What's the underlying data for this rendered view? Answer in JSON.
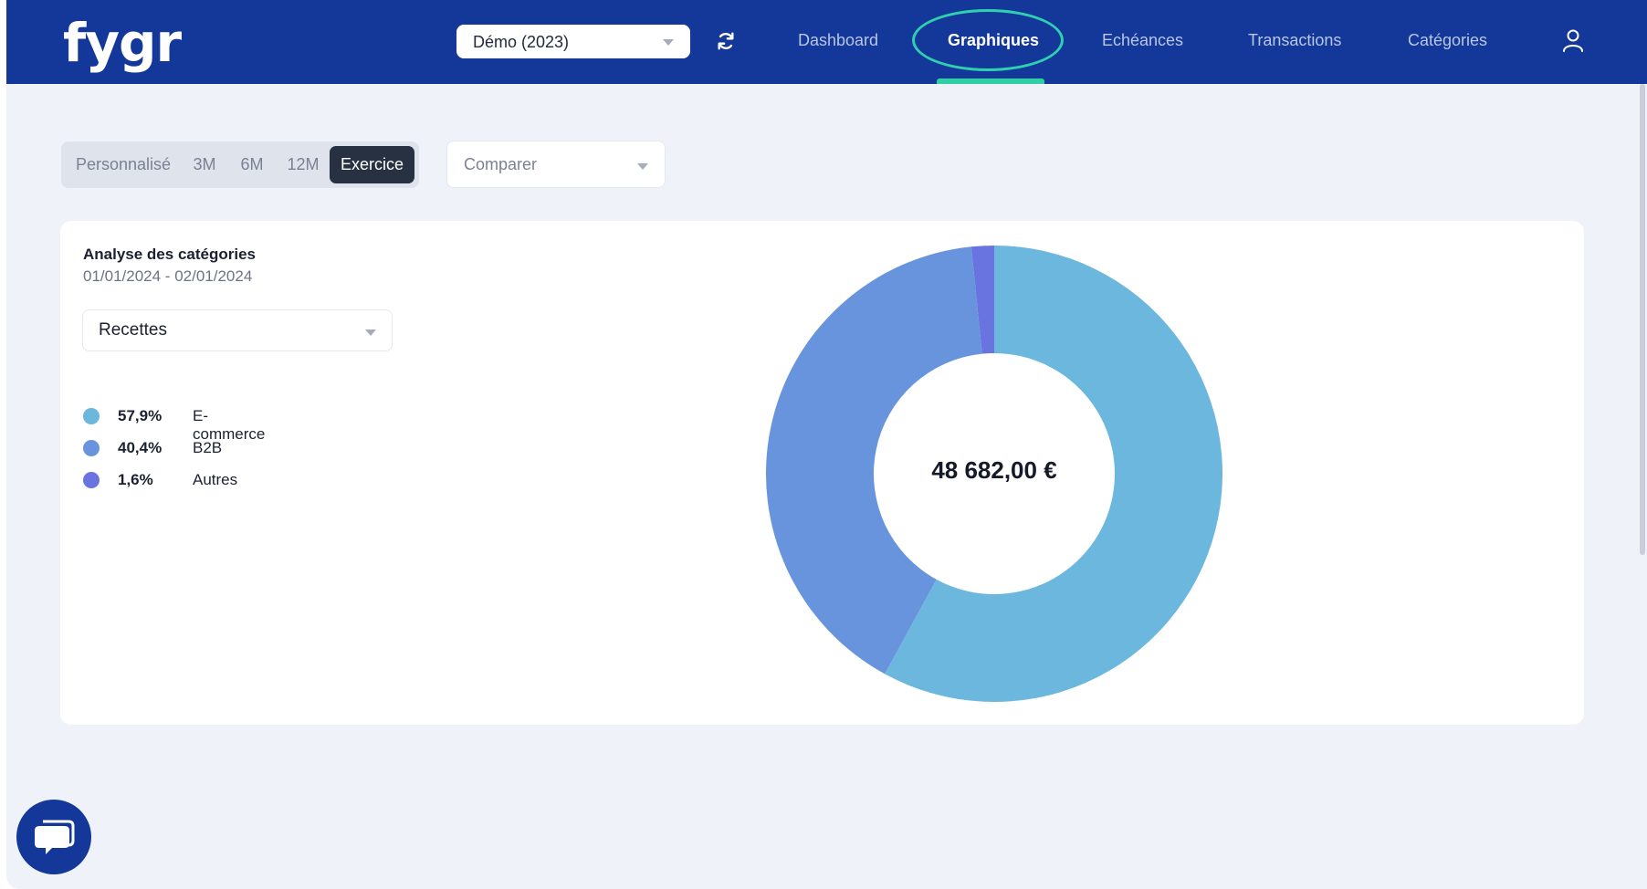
{
  "brand": {
    "logo": "fygr"
  },
  "header": {
    "company": "Démo (2023)",
    "nav": [
      {
        "label": "Dashboard",
        "active": false
      },
      {
        "label": "Graphiques",
        "active": true
      },
      {
        "label": "Echéances",
        "active": false
      },
      {
        "label": "Transactions",
        "active": false
      },
      {
        "label": "Catégories",
        "active": false
      }
    ],
    "icons": {
      "refresh": "refresh-icon",
      "user": "user-icon"
    }
  },
  "filters": {
    "periods": [
      {
        "label": "Personnalisé",
        "active": false
      },
      {
        "label": "3M",
        "active": false
      },
      {
        "label": "6M",
        "active": false
      },
      {
        "label": "12M",
        "active": false
      },
      {
        "label": "Exercice",
        "active": true
      }
    ],
    "compare_placeholder": "Comparer"
  },
  "card": {
    "title": "Analyse des catégories",
    "date_range": "01/01/2024 - 02/01/2024",
    "type_selected": "Recettes",
    "total": "48 682,00 €"
  },
  "chart_data": {
    "type": "pie",
    "title": "",
    "categories": [
      "E-commerce",
      "B2B",
      "Autres"
    ],
    "values": [
      57.9,
      40.4,
      1.6
    ],
    "labels": [
      "57,9%",
      "40,4%",
      "1,6%"
    ],
    "colors": [
      "#6bb7dd",
      "#6894dd",
      "#6a74e0"
    ],
    "donut": true,
    "legend": "left"
  },
  "chat": {
    "icon": "chat-bubble-icon"
  }
}
